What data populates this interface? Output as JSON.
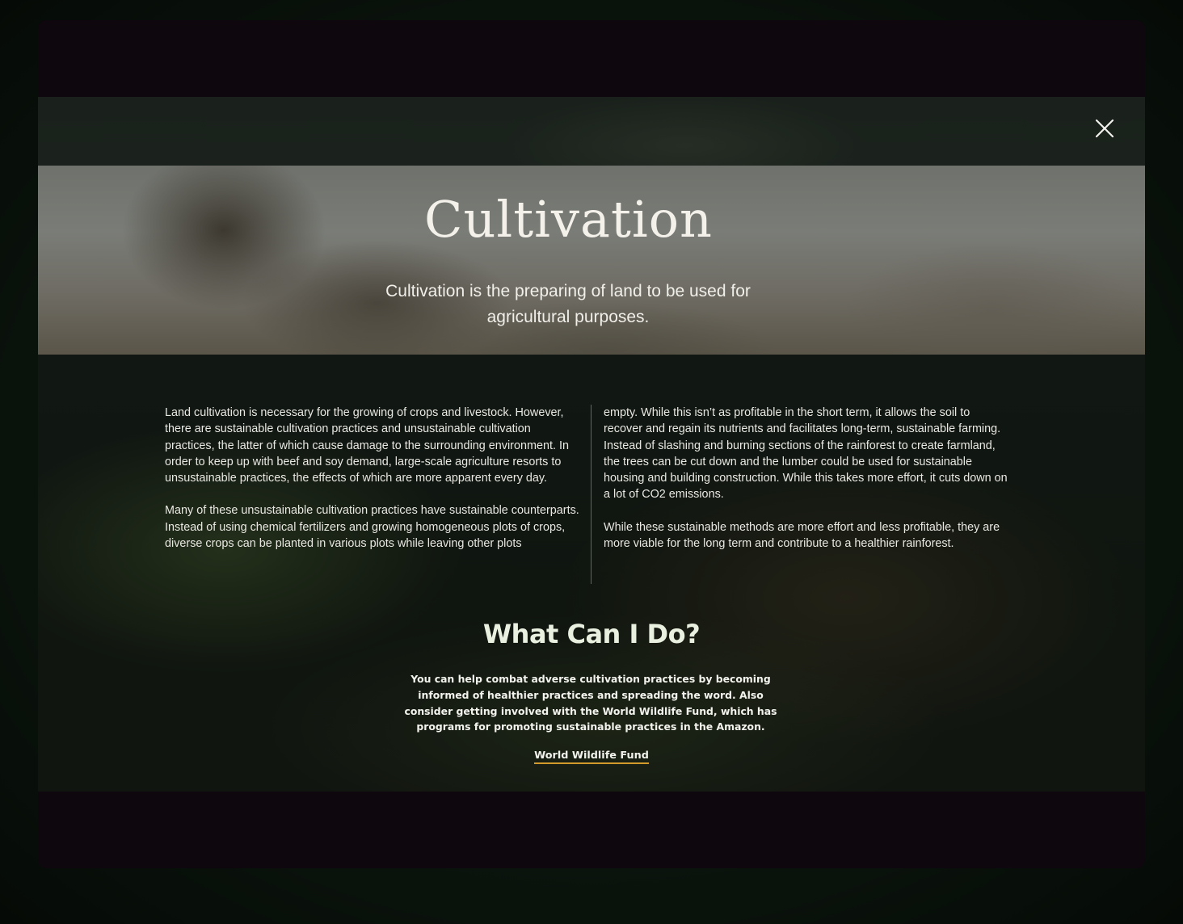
{
  "modal": {
    "close_icon": "close-icon",
    "hero": {
      "title": "Cultivation",
      "subtitle": "Cultivation is the preparing of land to be used for agricultural purposes."
    },
    "left_column": {
      "p1": "Land cultivation is necessary for the growing of crops and livestock. However, there are sustainable cultivation practices and unsustainable cultivation practices, the latter of which cause damage to the surrounding environment. In order to keep up with beef and soy demand, large-scale agriculture resorts to unsustainable practices, the effects of which are more apparent every day.",
      "p2a": "Many of these unsustainable cultivation practices have sustainable counterparts.",
      "p2b": "Instead of using chemical fertilizers and growing homogeneous plots of crops, diverse crops can be planted in various plots while leaving other plots"
    },
    "right_column": {
      "p1": "empty. While this isn’t as profitable in the short term, it allows the soil to recover and regain its nutrients and facilitates long-term, sustainable farming.",
      "p2": "Instead of slashing and burning sections of the rainforest to create farmland,",
      "p3": "the trees can be cut down and the lumber could be used for sustainable housing and building construction. While this takes more effort, it cuts down on a lot of CO2 emissions.",
      "p4": "While these sustainable methods are more effort and less profitable, they are more viable for the long term and contribute to a healthier rainforest."
    },
    "what_can_i_do": {
      "title": "What Can I Do?",
      "text": "You can help combat adverse cultivation practices by becoming informed of healthier practices and spreading the word. Also consider getting involved with the World Wildlife Fund, which has programs for promoting sustainable practices in the Amazon.",
      "link_label": "World Wildlife Fund"
    }
  },
  "colors": {
    "link_underline": "#d19a2a",
    "window_bg": "#0e070d",
    "text": "#e9e8e2"
  }
}
